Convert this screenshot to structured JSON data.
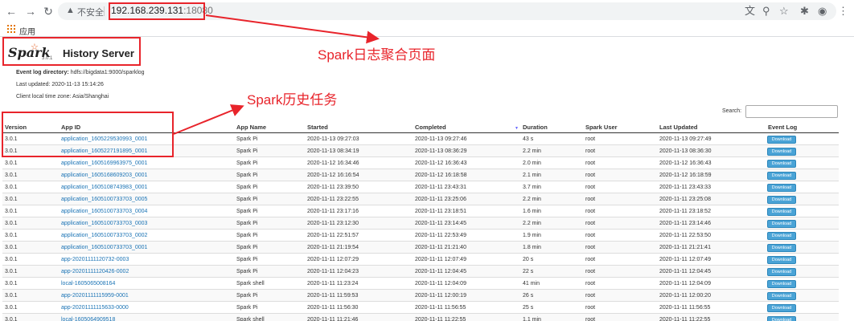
{
  "browser": {
    "back_icon": "arrow-left",
    "forward_icon": "arrow-right",
    "reload_icon": "reload",
    "security_label": "不安全",
    "url_host": "192.168.239.131",
    "url_port": ":18080",
    "bookmarks": {
      "apps_label": "应用"
    }
  },
  "header": {
    "logo_text": "Spark",
    "version": "3.0.1",
    "title": "History Server"
  },
  "info": {
    "event_log_label": "Event log directory:",
    "event_log_value": "hdfs://bigdata1:9000/sparklog",
    "last_updated_label": "Last updated:",
    "last_updated_value": "2020-11-13 15:14:26",
    "timezone_label": "Client local time zone:",
    "timezone_value": "Asia/Shanghai"
  },
  "search": {
    "label": "Search:",
    "value": ""
  },
  "table": {
    "columns": [
      "Version",
      "App ID",
      "App Name",
      "Started",
      "Completed",
      "Duration",
      "Spark User",
      "Last Updated",
      "Event Log"
    ],
    "sorted_column": "Duration",
    "download_label": "Download",
    "rows": [
      [
        "3.0.1",
        "application_1605229530993_0001",
        "Spark Pi",
        "2020-11-13 09:27:03",
        "2020-11-13 09:27:46",
        "43 s",
        "root",
        "2020-11-13 09:27:49"
      ],
      [
        "3.0.1",
        "application_1605227191895_0001",
        "Spark Pi",
        "2020-11-13 08:34:19",
        "2020-11-13 08:36:29",
        "2.2 min",
        "root",
        "2020-11-13 08:36:30"
      ],
      [
        "3.0.1",
        "application_1605169963975_0001",
        "Spark Pi",
        "2020-11-12 16:34:46",
        "2020-11-12 16:36:43",
        "2.0 min",
        "root",
        "2020-11-12 16:36:43"
      ],
      [
        "3.0.1",
        "application_1605168609203_0001",
        "Spark Pi",
        "2020-11-12 16:16:54",
        "2020-11-12 16:18:58",
        "2.1 min",
        "root",
        "2020-11-12 16:18:59"
      ],
      [
        "3.0.1",
        "application_1605108743983_0001",
        "Spark Pi",
        "2020-11-11 23:39:50",
        "2020-11-11 23:43:31",
        "3.7 min",
        "root",
        "2020-11-11 23:43:33"
      ],
      [
        "3.0.1",
        "application_1605100733703_0005",
        "Spark Pi",
        "2020-11-11 23:22:55",
        "2020-11-11 23:25:06",
        "2.2 min",
        "root",
        "2020-11-11 23:25:08"
      ],
      [
        "3.0.1",
        "application_1605100733703_0004",
        "Spark Pi",
        "2020-11-11 23:17:16",
        "2020-11-11 23:18:51",
        "1.6 min",
        "root",
        "2020-11-11 23:18:52"
      ],
      [
        "3.0.1",
        "application_1605100733703_0003",
        "Spark Pi",
        "2020-11-11 23:12:30",
        "2020-11-11 23:14:45",
        "2.2 min",
        "root",
        "2020-11-11 23:14:46"
      ],
      [
        "3.0.1",
        "application_1605100733703_0002",
        "Spark Pi",
        "2020-11-11 22:51:57",
        "2020-11-11 22:53:49",
        "1.9 min",
        "root",
        "2020-11-11 22:53:50"
      ],
      [
        "3.0.1",
        "application_1605100733703_0001",
        "Spark Pi",
        "2020-11-11 21:19:54",
        "2020-11-11 21:21:40",
        "1.8 min",
        "root",
        "2020-11-11 21:21:41"
      ],
      [
        "3.0.1",
        "app-20201111120732-0003",
        "Spark Pi",
        "2020-11-11 12:07:29",
        "2020-11-11 12:07:49",
        "20 s",
        "root",
        "2020-11-11 12:07:49"
      ],
      [
        "3.0.1",
        "app-20201111120426-0002",
        "Spark Pi",
        "2020-11-11 12:04:23",
        "2020-11-11 12:04:45",
        "22 s",
        "root",
        "2020-11-11 12:04:45"
      ],
      [
        "3.0.1",
        "local-1605065008164",
        "Spark shell",
        "2020-11-11 11:23:24",
        "2020-11-11 12:04:09",
        "41 min",
        "root",
        "2020-11-11 12:04:09"
      ],
      [
        "3.0.1",
        "app-20201111115959-0001",
        "Spark Pi",
        "2020-11-11 11:59:53",
        "2020-11-11 12:00:19",
        "26 s",
        "root",
        "2020-11-11 12:00:20"
      ],
      [
        "3.0.1",
        "app-20201111115633-0000",
        "Spark Pi",
        "2020-11-11 11:56:30",
        "2020-11-11 11:56:55",
        "25 s",
        "root",
        "2020-11-11 11:56:55"
      ],
      [
        "3.0.1",
        "local-1605064909518",
        "Spark shell",
        "2020-11-11 11:21:46",
        "2020-11-11 11:22:55",
        "1.1 min",
        "root",
        "2020-11-11 11:22:55"
      ]
    ]
  },
  "annotations": {
    "page_note": "Spark日志聚合页面",
    "tasks_note": "Spark历史任务",
    "color": "#e8242b"
  }
}
